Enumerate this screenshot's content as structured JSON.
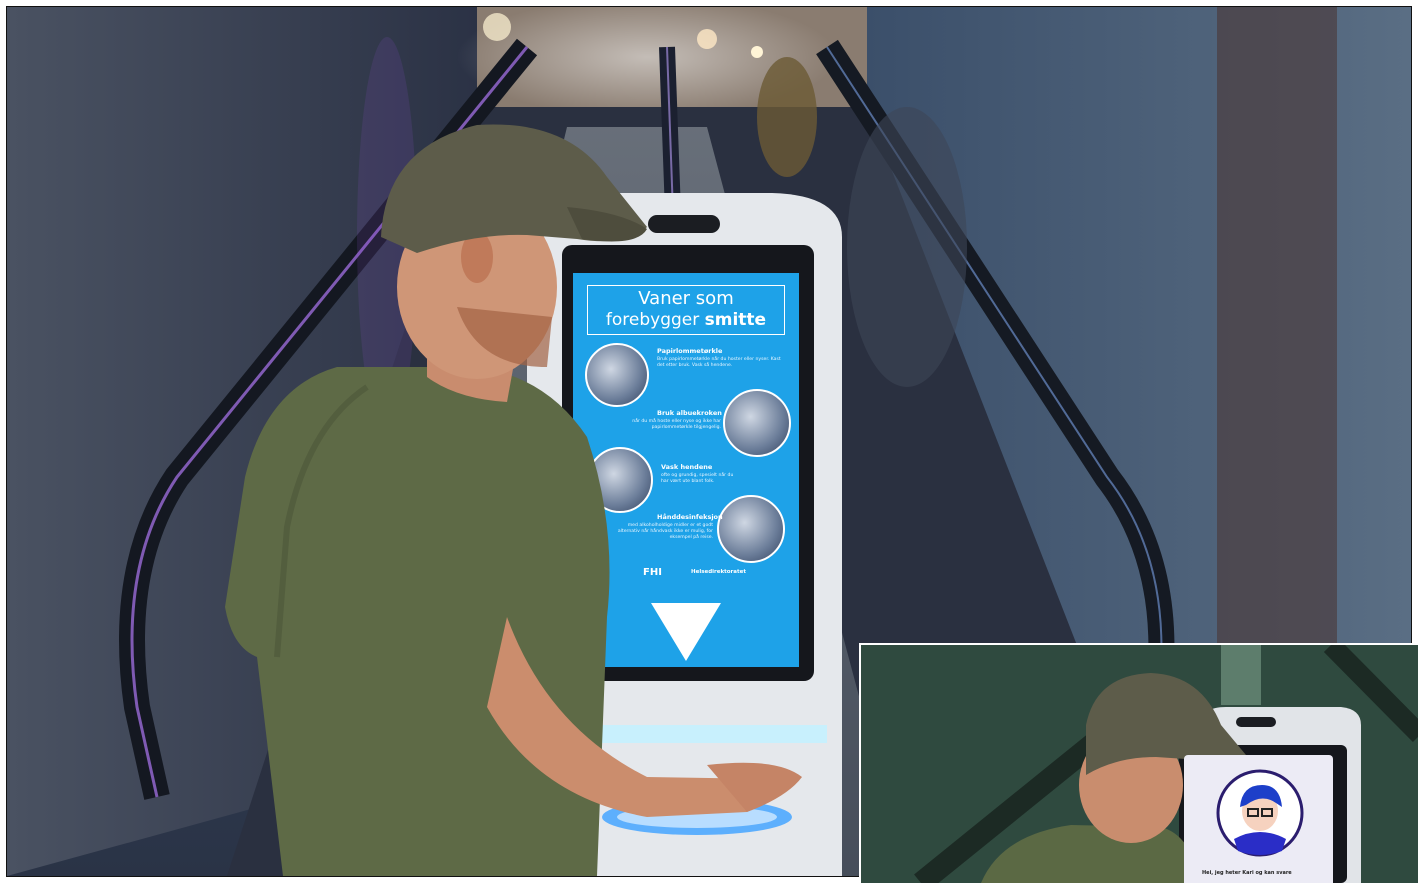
{
  "scene": {
    "description_icons": [
      "escalator",
      "hand-sanitizer-kiosk",
      "man-in-cap"
    ]
  },
  "kiosk_screen": {
    "title_line1": "Vaner som",
    "title_line2_prefix": "forebygger ",
    "title_line2_bold": "smitte",
    "tips": [
      {
        "title": "Papirlommetørkle",
        "body": "Bruk papirlommetørkle når du hoster eller nyser. Kast det etter bruk. Vask så hendene."
      },
      {
        "title": "Bruk albuekroken",
        "body": "når du må hoste eller nyse og ikke har papirlommetørkle tilgjengelig."
      },
      {
        "title": "Vask hendene",
        "body": "ofte og grundig, spesielt når du har vært ute blant folk."
      },
      {
        "title": "Hånddesinfeksjon",
        "body": "med alkoholholdige midler er et godt alternativ når håndvask ikke er mulig, for eksempel på reise."
      }
    ],
    "logo_left": "FHI",
    "logo_right": "Helsedirektoratet",
    "background_color": "#1ea2e8"
  },
  "inset": {
    "speech_text": "Hei, jeg heter Kari og kan svare"
  }
}
